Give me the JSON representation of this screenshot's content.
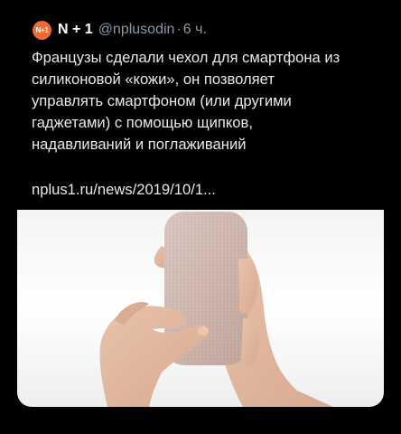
{
  "tweet": {
    "avatar_text": "N+1",
    "author_name": "N + 1",
    "handle": "@nplusodin",
    "separator": "·",
    "time": "6 ч.",
    "text": "Французы сделали чехол для смартфона из\nсиликоновой «кожи», он позволяет\nуправлять смартфоном (или другими\nгаджетами) с помощью щипков,\nнадавливаний и поглаживаний",
    "link": "nplus1.ru/news/2019/10/1..."
  },
  "colors": {
    "background": "#000000",
    "avatar": "#f06a35",
    "text": "#e7e9ea",
    "muted": "#8b98a5"
  }
}
